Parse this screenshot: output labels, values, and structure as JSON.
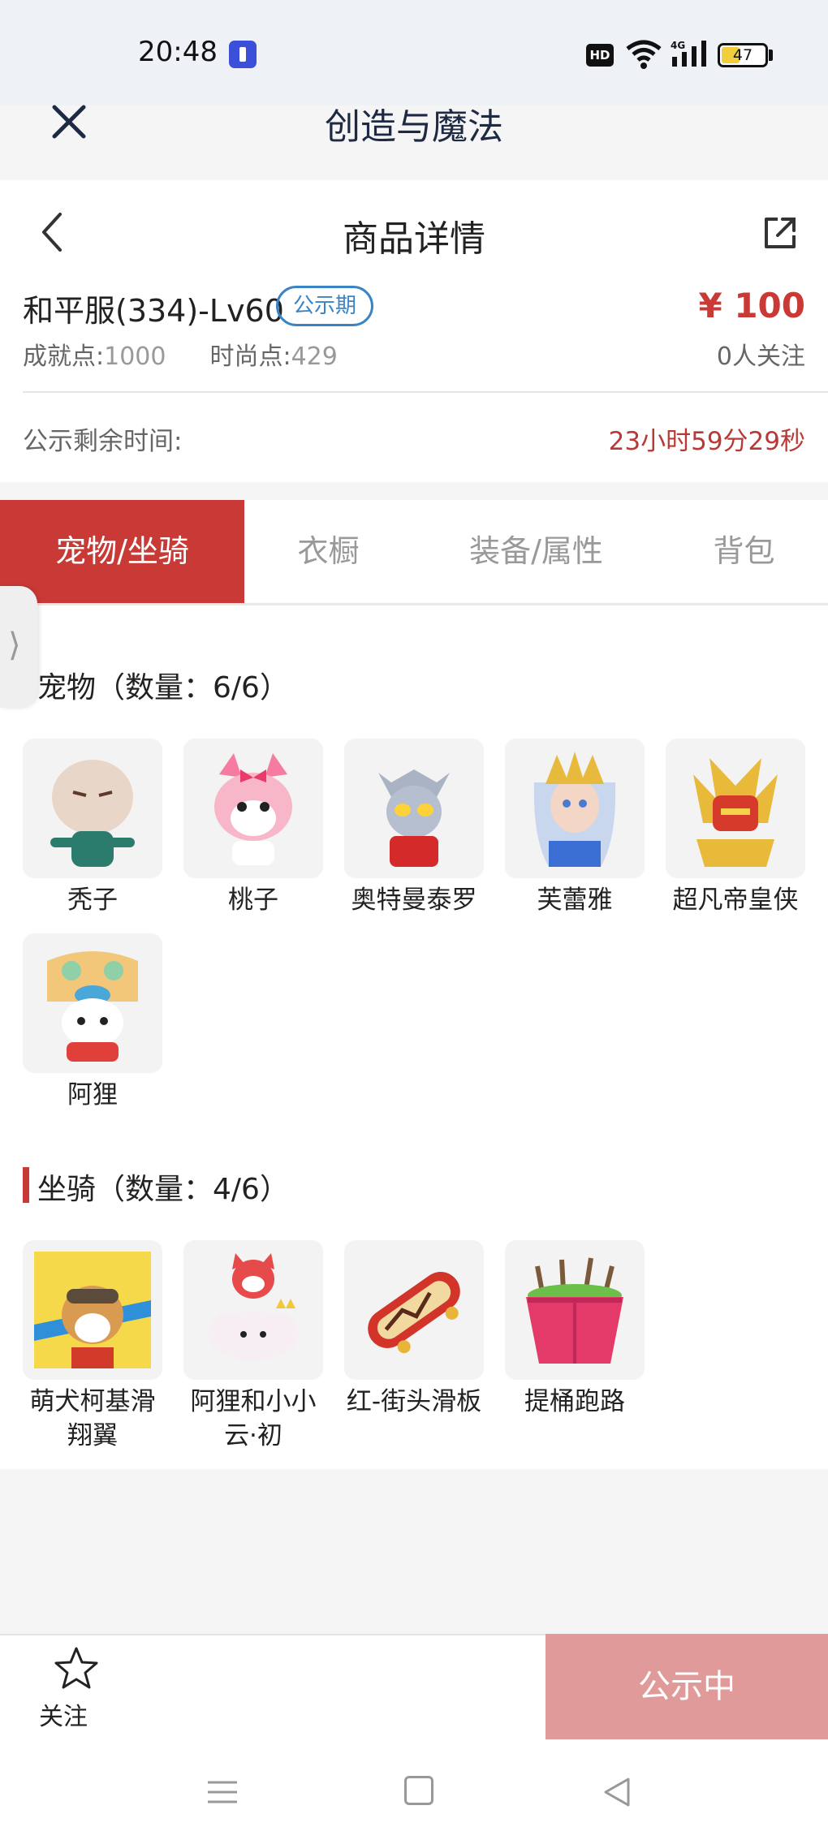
{
  "status_bar": {
    "time": "20:48",
    "hd": "HD",
    "network": "4G",
    "battery": "47"
  },
  "app": {
    "title": "创造与魔法"
  },
  "page": {
    "title": "商品详情"
  },
  "product": {
    "name": "和平服(334)-Lv60",
    "status_tag": "公示期",
    "price": "¥ 100",
    "achievement_label": "成就点:",
    "achievement_value": "1000",
    "fashion_label": "时尚点:",
    "fashion_value": "429",
    "followers": "0人关注"
  },
  "countdown": {
    "label": "公示剩余时间:",
    "value": "23小时59分29秒"
  },
  "tabs": [
    {
      "label": "宠物/坐骑",
      "active": true
    },
    {
      "label": "衣橱",
      "active": false
    },
    {
      "label": "装备/属性",
      "active": false
    },
    {
      "label": "背包",
      "active": false
    }
  ],
  "pets": {
    "title": "宠物（数量：6/6）",
    "items": [
      {
        "name": "秃子",
        "icon": "bald-character-icon"
      },
      {
        "name": "桃子",
        "icon": "pink-cat-icon"
      },
      {
        "name": "奥特曼泰罗",
        "icon": "ultraman-icon"
      },
      {
        "name": "芙蕾雅",
        "icon": "freya-icon"
      },
      {
        "name": "超凡帝皇侠",
        "icon": "golden-armor-icon"
      },
      {
        "name": "阿狸",
        "icon": "ali-fox-icon"
      }
    ]
  },
  "mounts": {
    "title": "坐骑（数量：4/6）",
    "items": [
      {
        "name": "萌犬柯基滑翔翼",
        "icon": "corgi-glider-icon"
      },
      {
        "name": "阿狸和小小云·初",
        "icon": "ali-cloud-icon"
      },
      {
        "name": "红-街头滑板",
        "icon": "skateboard-icon"
      },
      {
        "name": "提桶跑路",
        "icon": "bucket-icon"
      }
    ]
  },
  "bottom": {
    "follow_label": "关注",
    "action_label": "公示中"
  },
  "colors": {
    "accent": "#c93a36",
    "tag_blue": "#3a84c6",
    "button_disabled": "#e09a99"
  }
}
